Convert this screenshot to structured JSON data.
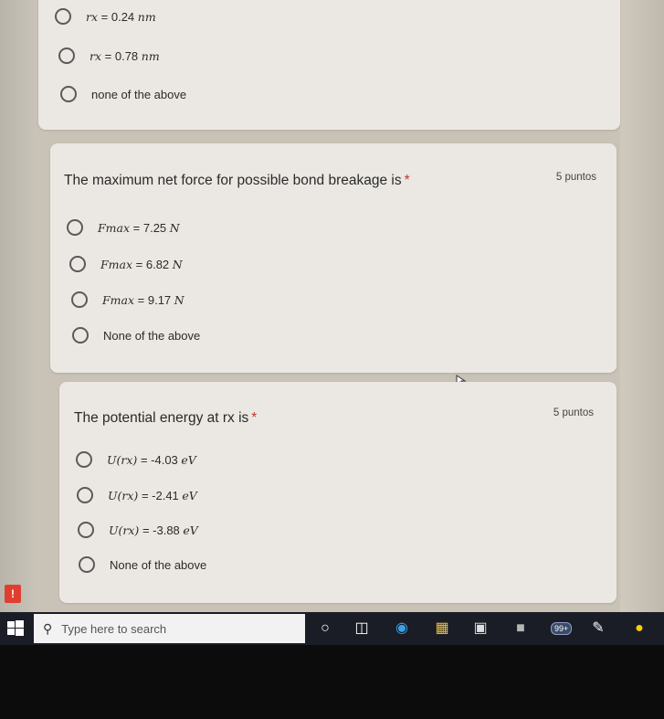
{
  "q1": {
    "options": [
      {
        "var": "rx",
        "rest": " = 0.24 ",
        "unit": "nm"
      },
      {
        "var": "rx",
        "rest": " = 0.78 ",
        "unit": "nm"
      },
      {
        "plain": "none of the above"
      }
    ]
  },
  "q2": {
    "title": "The maximum net force for possible bond breakage is",
    "required": "*",
    "points": "5 puntos",
    "options": [
      {
        "var": "Fmax",
        "rest": " = 7.25 ",
        "unit": "N"
      },
      {
        "var": "Fmax",
        "rest": " = 6.82 ",
        "unit": "N"
      },
      {
        "var": "Fmax",
        "rest": " = 9.17 ",
        "unit": "N"
      },
      {
        "plain": "None of the above"
      }
    ]
  },
  "q3": {
    "title": "The potential energy at rx is",
    "required": "*",
    "points": "5 puntos",
    "options": [
      {
        "var": "U(rx)",
        "rest": " = -4.03 ",
        "unit": "eV"
      },
      {
        "var": "U(rx)",
        "rest": " = -2.41 ",
        "unit": "eV"
      },
      {
        "var": "U(rx)",
        "rest": " = -3.88 ",
        "unit": "eV"
      },
      {
        "plain": "None of the above"
      }
    ]
  },
  "taskbar": {
    "search_placeholder": "Type here to search",
    "mail_badge": "99+",
    "alert": "!"
  }
}
